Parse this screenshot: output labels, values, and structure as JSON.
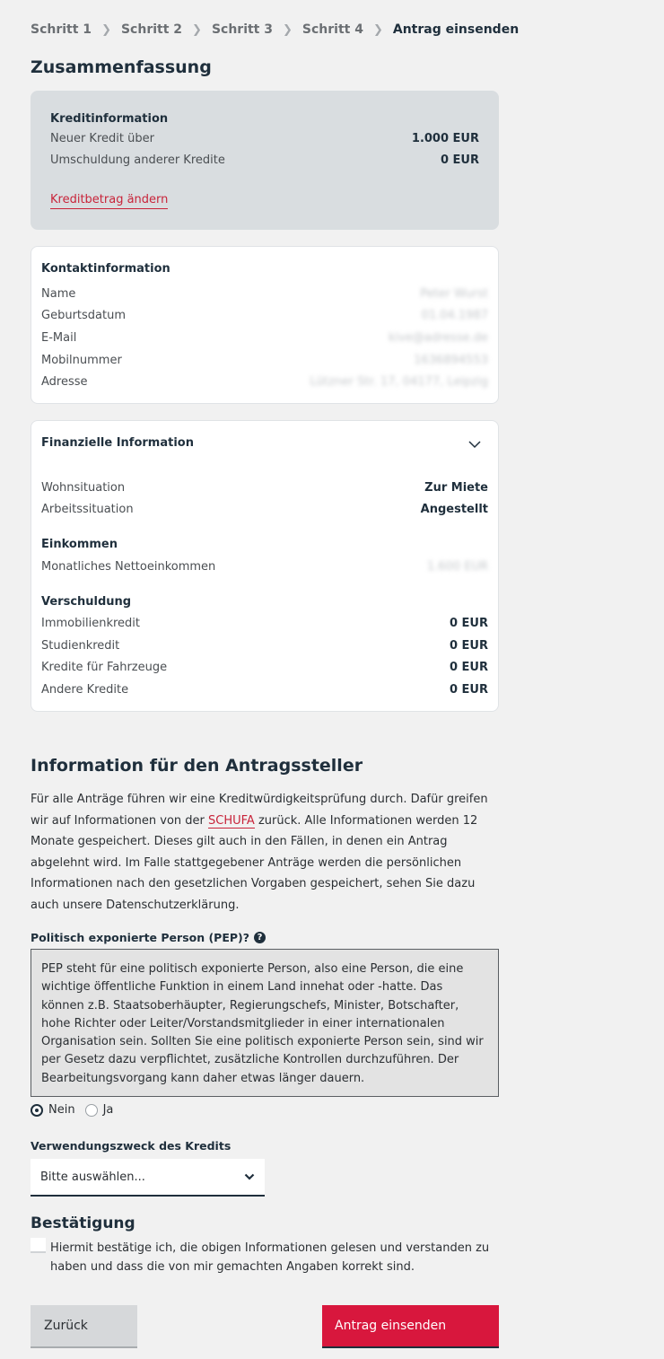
{
  "breadcrumb": [
    "Schritt 1",
    "Schritt 2",
    "Schritt 3",
    "Schritt 4",
    "Antrag einsenden"
  ],
  "summary_title": "Zusammenfassung",
  "credit": {
    "title": "Kreditinformation",
    "rows": [
      {
        "label": "Neuer Kredit über",
        "value": "1.000 EUR"
      },
      {
        "label": "Umschuldung anderer Kredite",
        "value": "0 EUR"
      }
    ],
    "change_link": "Kreditbetrag ändern"
  },
  "contact": {
    "title": "Kontaktinformation",
    "rows": [
      {
        "label": "Name",
        "value": "Peter Wurst"
      },
      {
        "label": "Geburtsdatum",
        "value": "01.04.1987"
      },
      {
        "label": "E-Mail",
        "value": "kive@adresse.de"
      },
      {
        "label": "Mobilnummer",
        "value": "1636894553"
      },
      {
        "label": "Adresse",
        "value": "Lützner Str. 17, 04177, Leipzig"
      }
    ]
  },
  "financial": {
    "title": "Finanzielle Information",
    "rows": [
      {
        "label": "Wohnsituation",
        "value": "Zur Miete"
      },
      {
        "label": "Arbeitssituation",
        "value": "Angestellt"
      }
    ],
    "income_title": "Einkommen",
    "income_rows": [
      {
        "label": "Monatliches Nettoeinkommen",
        "value": "1.600 EUR"
      }
    ],
    "debt_title": "Verschuldung",
    "debt_rows": [
      {
        "label": "Immobilienkredit",
        "value": "0 EUR"
      },
      {
        "label": "Studienkredit",
        "value": "0 EUR"
      },
      {
        "label": "Kredite für Fahrzeuge",
        "value": "0 EUR"
      },
      {
        "label": "Andere Kredite",
        "value": "0 EUR"
      }
    ]
  },
  "applicant_info": {
    "title": "Information für den Antragssteller",
    "text_before": "Für alle Anträge führen wir eine Kreditwürdigkeitsprüfung durch. Dafür greifen wir auf Informationen von der ",
    "schufa_link": "SCHUFA",
    "text_after": " zurück. Alle Informationen werden 12 Monate gespeichert. Dieses gilt auch in den Fällen, in denen ein Antrag abgelehnt wird. Im Falle stattgegebener Anträge werden die persönlichen Informationen nach den gesetzlichen Vorgaben gespeichert, sehen Sie dazu auch unsere Datenschutzerklärung."
  },
  "pep": {
    "label": "Politisch exponierte Person (PEP)?",
    "help_glyph": "?",
    "text": "PEP steht für eine politisch exponierte Person, also eine Person, die eine wichtige öffentliche Funktion in einem Land innehat oder -hatte. Das können z.B. Staatsoberhäupter, Regierungschefs, Minister, Botschafter, hohe Richter oder Leiter/Vorstandsmitglieder in einer internationalen Organisation sein. Sollten Sie eine politisch exponierte Person sein, sind wir per Gesetz dazu verpflichtet, zusätzliche Kontrollen durchzuführen. Der Bearbeitungsvorgang kann daher etwas länger dauern.",
    "options": [
      "Nein",
      "Ja"
    ],
    "selected": "Nein"
  },
  "purpose": {
    "label": "Verwendungszweck des Kredits",
    "value": "Bitte auswählen..."
  },
  "confirmation": {
    "title": "Bestätigung",
    "text": "Hiermit bestätige ich, die obigen Informationen gelesen und verstanden zu haben und dass die von mir gemachten Angaben korrekt sind."
  },
  "buttons": {
    "back": "Zurück",
    "submit": "Antrag einsenden"
  },
  "colors": {
    "accent_red": "#d8173d",
    "navy": "#1f2f3c"
  }
}
